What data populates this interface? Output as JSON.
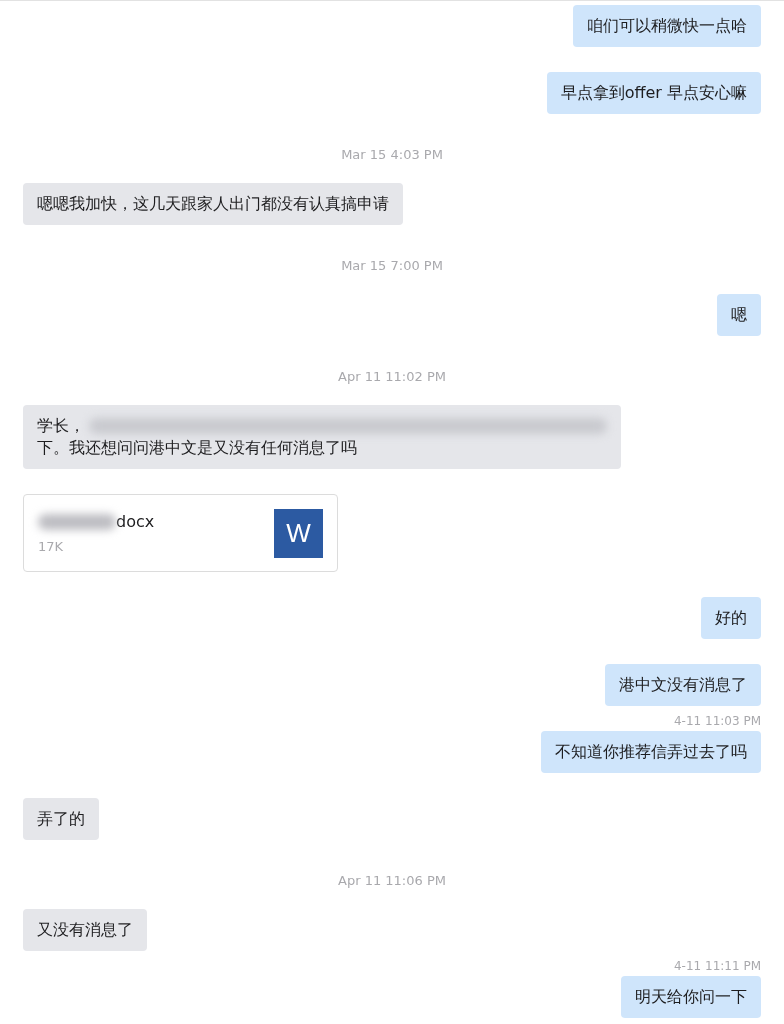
{
  "messages": [
    {
      "kind": "outgoing",
      "text": "咱们可以稍微快一点哈"
    },
    {
      "kind": "outgoing",
      "text": "早点拿到offer 早点安心嘛"
    },
    {
      "kind": "timestamp",
      "text": "Mar 15 4:03 PM"
    },
    {
      "kind": "incoming",
      "text": "嗯嗯我加快，这几天跟家人出门都没有认真搞申请"
    },
    {
      "kind": "timestamp",
      "text": "Mar 15 7:00 PM"
    },
    {
      "kind": "outgoing",
      "text": "嗯"
    },
    {
      "kind": "timestamp",
      "text": "Apr 11 11:02 PM"
    },
    {
      "kind": "redacted",
      "before": "学长，",
      "after": "下。我还想问问港中文是又没有任何消息了吗"
    },
    {
      "kind": "file",
      "name": "docx",
      "size": "17K",
      "icon_letter": "W"
    },
    {
      "kind": "outgoing",
      "text": "好的"
    },
    {
      "kind": "outgoing",
      "text": "港中文没有消息了"
    },
    {
      "kind": "outgoing",
      "time": "4-11 11:03 PM",
      "text": "不知道你推荐信弄过去了吗"
    },
    {
      "kind": "incoming",
      "text": "弄了的"
    },
    {
      "kind": "timestamp",
      "text": "Apr 11 11:06 PM"
    },
    {
      "kind": "incoming",
      "text": "又没有消息了"
    },
    {
      "kind": "outgoing",
      "time": "4-11 11:11 PM",
      "text": "明天给你问一下"
    }
  ]
}
